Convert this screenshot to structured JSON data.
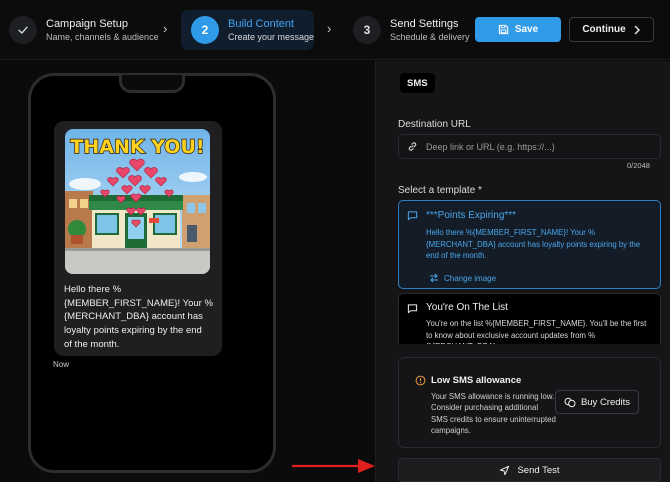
{
  "colors": {
    "accent": "#2f9ae8",
    "accent_text": "#45a4f0",
    "warning": "#e89a3c",
    "annotation_arrow": "#e0201c"
  },
  "stepper": {
    "steps": [
      {
        "number": "",
        "icon": "check-icon",
        "title": "Campaign Setup",
        "subtitle": "Name, channels & audience",
        "state": "completed"
      },
      {
        "number": "2",
        "title": "Build Content",
        "subtitle": "Create your message",
        "state": "active"
      },
      {
        "number": "3",
        "title": "Send Settings",
        "subtitle": "Schedule & delivery",
        "state": "pending"
      }
    ],
    "save_label": "Save",
    "continue_label": "Continue"
  },
  "preview": {
    "image_caption": "THANK YOU!",
    "message": "Hello there %\n{MEMBER_FIRST_NAME}! Your %\n{MERCHANT_DBA} account has\nloyalty points expiring by the end\nof the month.",
    "timestamp": "Now"
  },
  "panel": {
    "channel_chip": "SMS",
    "destination_url": {
      "label": "Destination URL",
      "placeholder": "Deep link or URL (e.g. https://...)",
      "value": "",
      "counter": "0/2048"
    },
    "template_label": "Select a template *",
    "templates": [
      {
        "title": "***Points Expiring***",
        "body": "Hello there %{MEMBER_FIRST_NAME}! Your %{MERCHANT_DBA} account has loyalty points expiring by the end of the month.",
        "action": "Change image",
        "selected": true
      },
      {
        "title": "You're On The List",
        "body": "You're on the list %{MEMBER_FIRST_NAME}. You'll be the first to know about exclusive account updates from %{MERCHANT_DBA}.",
        "selected": false
      }
    ],
    "alert": {
      "title": "Low SMS allowance",
      "body": "Your SMS allowance is running low. Consider purchasing additional SMS credits to ensure uninterrupted campaigns.",
      "button": "Buy Credits"
    },
    "send_test_label": "Send Test"
  }
}
